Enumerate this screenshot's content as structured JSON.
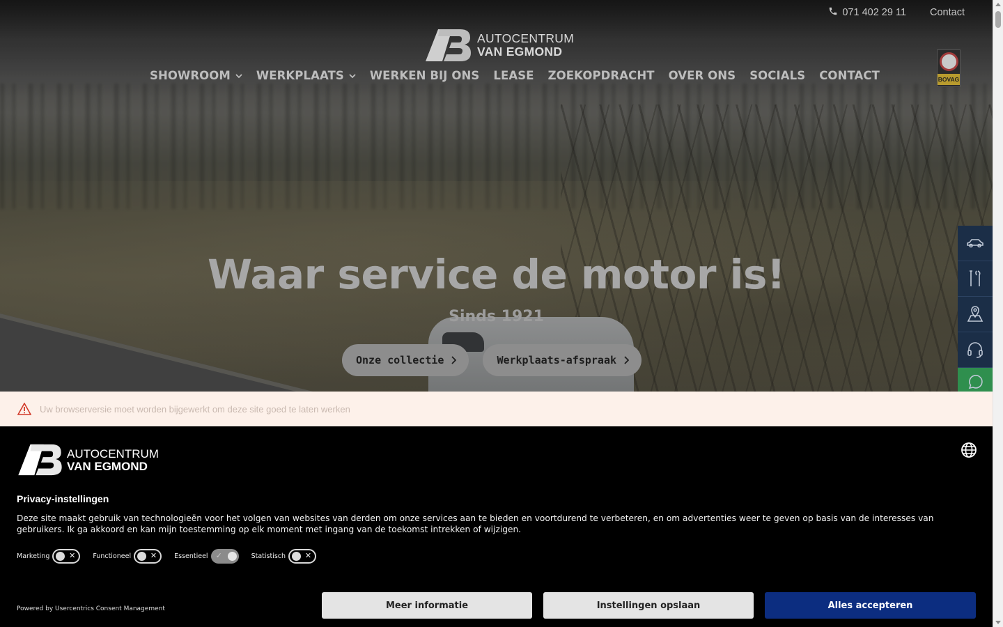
{
  "topbar": {
    "phone": "071 402 29 11",
    "contact": "Contact"
  },
  "brand": {
    "line1": "AUTOCENTRUM",
    "line2": "VAN EGMOND"
  },
  "nav": [
    {
      "label": "SHOWROOM",
      "dropdown": true
    },
    {
      "label": "WERKPLAATS",
      "dropdown": true
    },
    {
      "label": "WERKEN BIJ ONS",
      "dropdown": false
    },
    {
      "label": "LEASE",
      "dropdown": false
    },
    {
      "label": "ZOEKOPDRACHT",
      "dropdown": false
    },
    {
      "label": "OVER ONS",
      "dropdown": false
    },
    {
      "label": "SOCIALS",
      "dropdown": false
    },
    {
      "label": "CONTACT",
      "dropdown": false
    }
  ],
  "bovag": "BOVAG",
  "hero": {
    "headline": "Waar service de motor is!",
    "sub": "Sinds 1921",
    "cta1": "Onze collectie",
    "cta2": "Werkplaats-afspraak"
  },
  "side_icons": [
    "car-icon",
    "tools-icon",
    "map-location-icon",
    "headset-icon",
    "whatsapp-icon"
  ],
  "warning": "Uw browserversie moet worden bijgewerkt om deze site goed te laten werken",
  "consent": {
    "title": "Privacy-instellingen",
    "text": "Deze site maakt gebruik van technologieën voor het volgen van websites van derden om onze services aan te bieden en voortdurend te verbeteren, en om advertenties weer te geven op basis van de interesses van gebruikers. Ik ga akkoord en kan mijn toestemming op elk moment met ingang van de toekomst intrekken of wijzigen.",
    "toggles": [
      {
        "label": "Marketing",
        "on": false
      },
      {
        "label": "Functioneel",
        "on": false
      },
      {
        "label": "Essentieel",
        "on": true
      },
      {
        "label": "Statistisch",
        "on": false
      }
    ],
    "powered": "Powered by Usercentrics Consent Management",
    "btn_more": "Meer informatie",
    "btn_save": "Instellingen opslaan",
    "btn_accept": "Alles accepteren"
  },
  "colors": {
    "accept_blue": "#0c2d80",
    "side_blue": "#1b2e47",
    "whatsapp_green": "#2f8f4e"
  }
}
